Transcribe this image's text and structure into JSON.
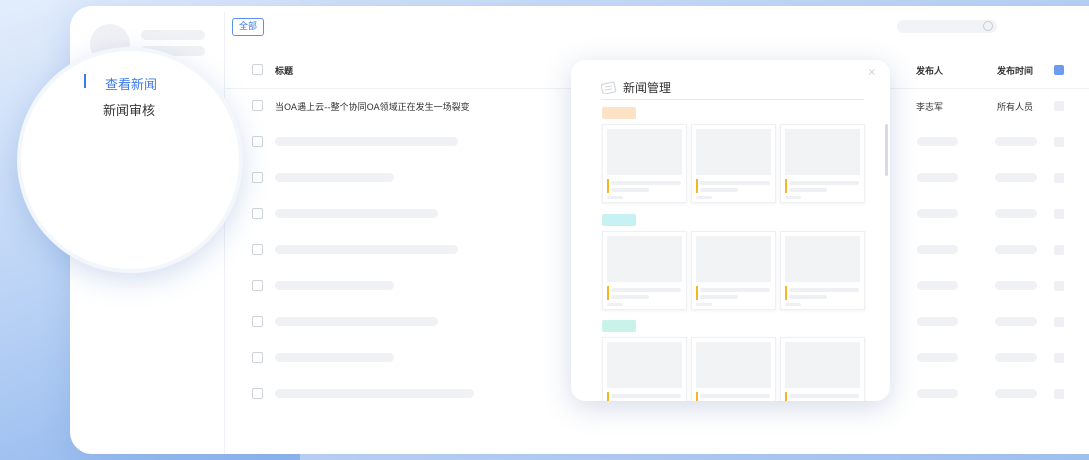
{
  "toolbar": {
    "filter_all": "全部"
  },
  "table": {
    "headers": {
      "title": "标题",
      "publisher": "发布人",
      "publish_time": "发布时间"
    },
    "first_row": {
      "title": "当OA遇上云--整个协同OA领域正在发生一场裂变",
      "publisher": "李志军",
      "publish_time": "所有人员"
    }
  },
  "sidebar": {
    "items": [
      {
        "label": "查看新闻",
        "active": true
      },
      {
        "label": "新闻审核",
        "active": false
      }
    ]
  },
  "popup": {
    "title": "新闻管理",
    "close_glyph": "×"
  },
  "colors": {
    "accent": "#3d7ae6",
    "tag_orange": "#fde3c6",
    "tag_cyan": "#c8f1f3",
    "tag_green": "#c9f2e9",
    "tile_accent": "#f5b624"
  }
}
